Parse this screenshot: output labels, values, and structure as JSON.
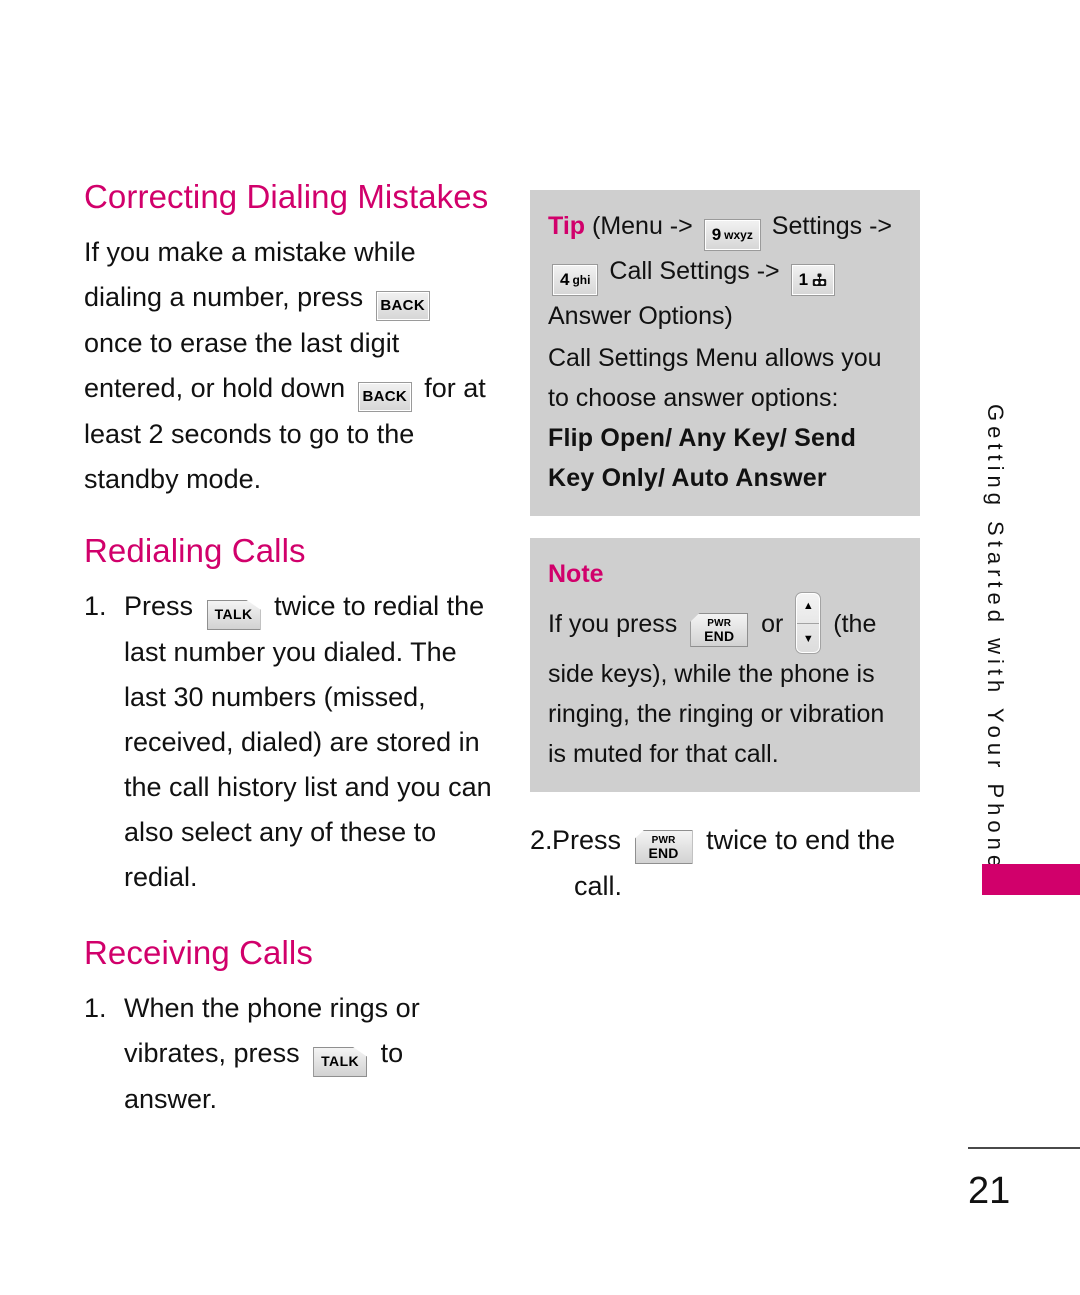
{
  "page": {
    "number": "21",
    "running_head": "Getting Started with Your Phone",
    "accent_color": "#D1006B",
    "callout_bg": "#CFCFCF"
  },
  "left_column": {
    "section1": {
      "heading": "Correcting Dialing Mistakes",
      "paragraph": {
        "part1": "If you make a mistake while dialing a number, press",
        "part2": "once to erase the last digit entered, or hold down",
        "part3": "for at least 2 seconds to go to the standby mode.",
        "key1_label": "BACK",
        "key2_label": "BACK"
      }
    },
    "section2": {
      "heading": "Redialing Calls",
      "steps": [
        {
          "number": "1.",
          "part1": "Press",
          "key_label": "TALK",
          "part2": "twice to redial the last number you dialed. The last 30 numbers (missed, received, dialed) are stored in the call history list and you can also select any of these to redial."
        }
      ]
    },
    "section3": {
      "heading": "Receiving Calls",
      "steps": [
        {
          "number": "1.",
          "part1": "When the phone rings or vibrates, press",
          "key_label": "TALK",
          "part2": "to answer."
        }
      ]
    }
  },
  "right_column": {
    "tip_box": {
      "label": "Tip",
      "line1_a": "(Menu ->",
      "key_9": {
        "digit": "9",
        "letters": "wxyz"
      },
      "line1_b": "Settings ->",
      "key_4": {
        "digit": "4",
        "letters": "ghi"
      },
      "line2_a": "Call Settings ->",
      "key_1": {
        "digit": "1",
        "icon": "voicemail-icon"
      },
      "line2_b": "Answer",
      "line3": "Options)",
      "body": "Call Settings Menu allows you to choose answer options:",
      "options_bold": "Flip Open/ Any Key/ Send Key Only/ Auto Answer"
    },
    "note_box": {
      "label": "Note",
      "part1": "If you press",
      "key_pwr_end": {
        "line1": "PWR",
        "line2": "END"
      },
      "part2": "or",
      "side_keys_icon": "side-keys-rocker-icon",
      "part3": "(the side keys), while the phone is ringing, the ringing or vibration is muted for that call."
    },
    "step2": {
      "number": "2.",
      "part1": "Press",
      "key_pwr_end": {
        "line1": "PWR",
        "line2": "END"
      },
      "part2": "twice to end the",
      "part3": "call."
    }
  }
}
